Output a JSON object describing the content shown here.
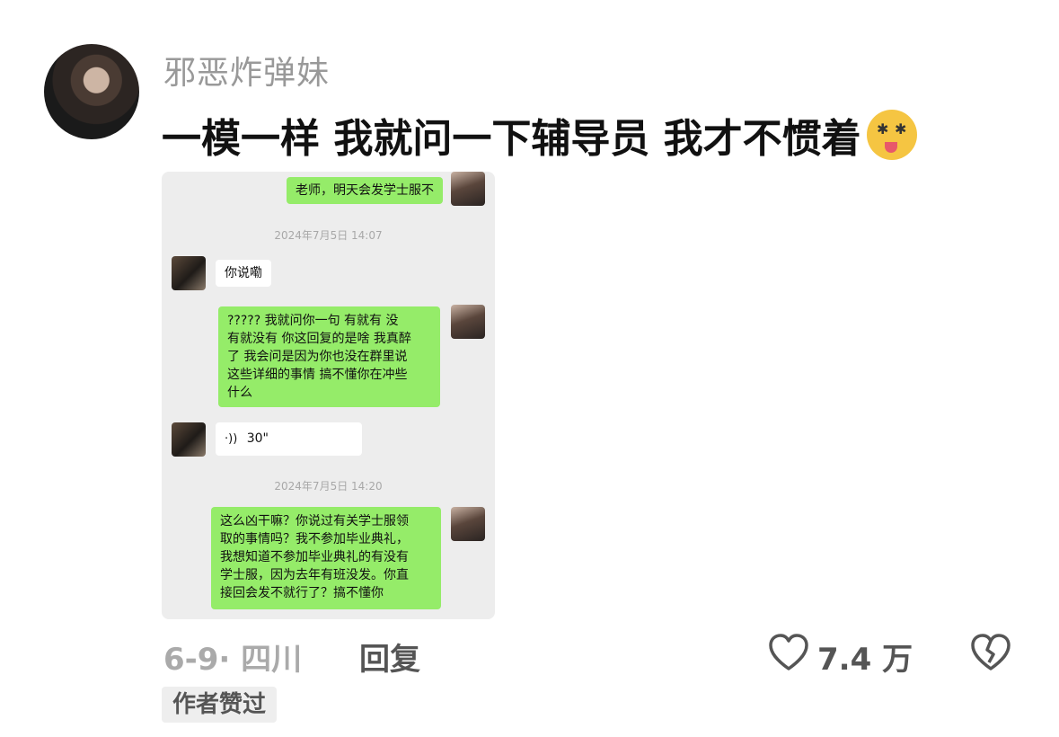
{
  "comment": {
    "username": "邪恶炸弹妹",
    "text": "一模一样 我就问一下辅导员 我才不惯着",
    "emoji": "drooling-crazy-face-emoji"
  },
  "chat_screenshot": {
    "messages": [
      {
        "side": "self",
        "text": "老师，明天会发学士服不"
      },
      {
        "side": "time",
        "text": "2024年7月5日 14:07"
      },
      {
        "side": "other",
        "text": "你说嘞"
      },
      {
        "side": "self",
        "lines": [
          "?????  我就问你一句 有就有 没",
          "有就没有 你这回复的是啥 我真醉",
          "了 我会问是因为你也没在群里说",
          "这些详细的事情 搞不懂你在冲些",
          "什么"
        ]
      },
      {
        "side": "other",
        "type": "voice",
        "text": "30\""
      },
      {
        "side": "time",
        "text": "2024年7月5日 14:20"
      },
      {
        "side": "self",
        "lines": [
          "这么凶干嘛？你说过有关学士服领",
          "取的事情吗？我不参加毕业典礼，",
          "我想知道不参加毕业典礼的有没有",
          "学士服，因为去年有班没发。你直",
          "接回会发不就行了？搞不懂你"
        ]
      }
    ]
  },
  "footer": {
    "date_location": "6-9· 四川",
    "reply_label": "回复",
    "like_count": "7.4 万",
    "author_liked_badge": "作者赞过"
  }
}
